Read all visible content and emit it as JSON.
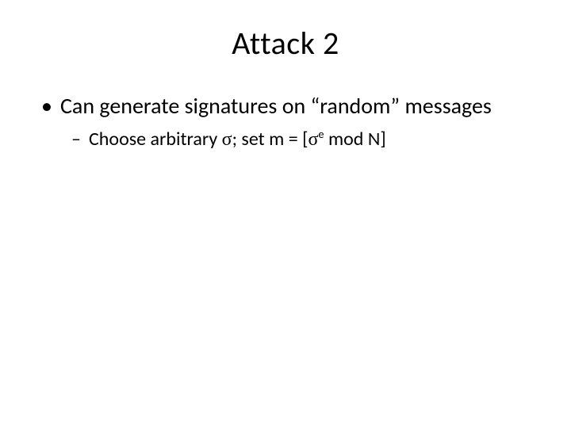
{
  "title": "Attack 2",
  "bullets": {
    "l1": {
      "text_a": "Can generate signatures on ",
      "text_b": "“random”",
      "text_c": " messages"
    },
    "l2": {
      "text_a": "Choose arbitrary ",
      "sigma1": "σ",
      "text_b": "; set m = [",
      "sigma2": "σ",
      "sup": "e",
      "text_c": " mod N]"
    }
  }
}
